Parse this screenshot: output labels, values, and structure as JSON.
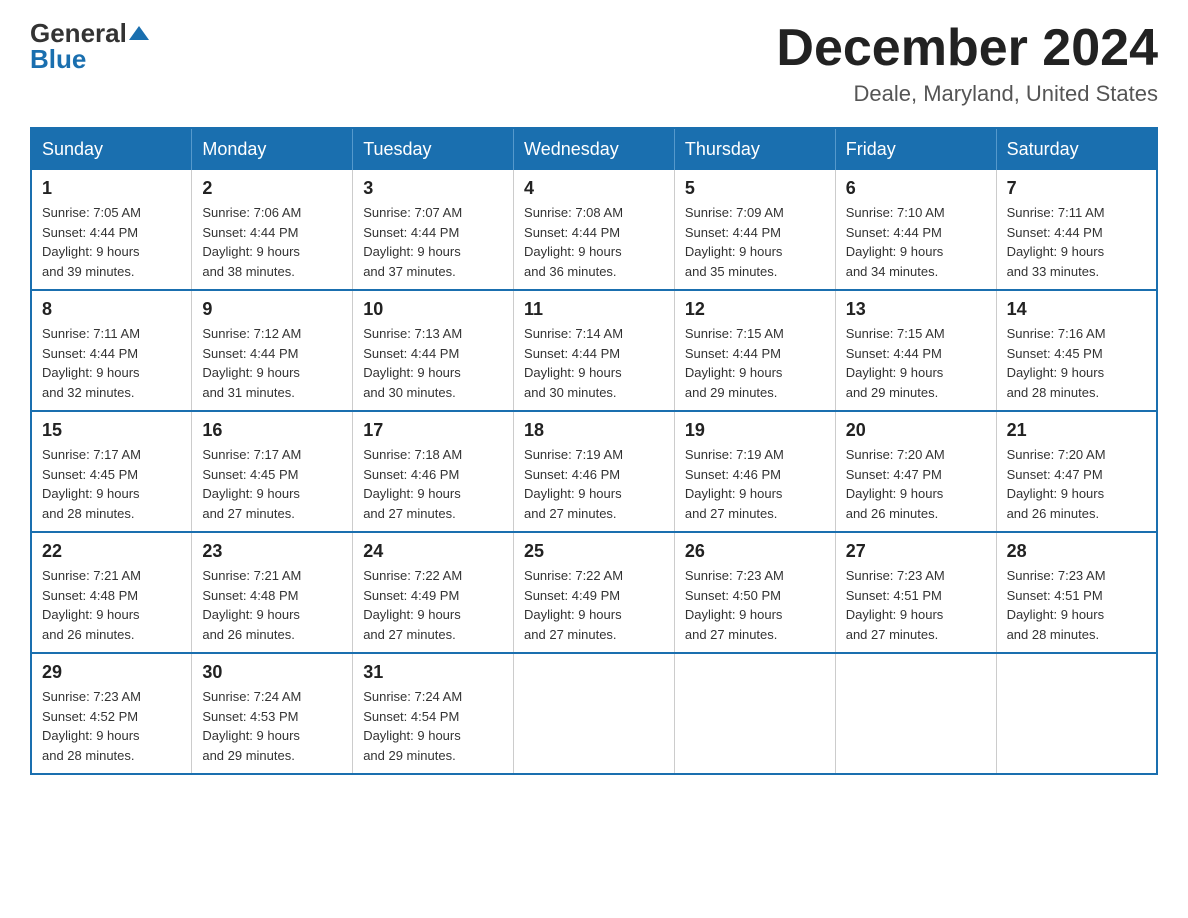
{
  "logo": {
    "general": "General",
    "blue": "Blue"
  },
  "title": {
    "month_year": "December 2024",
    "location": "Deale, Maryland, United States"
  },
  "weekdays": [
    "Sunday",
    "Monday",
    "Tuesday",
    "Wednesday",
    "Thursday",
    "Friday",
    "Saturday"
  ],
  "weeks": [
    [
      {
        "day": 1,
        "sunrise": "7:05 AM",
        "sunset": "4:44 PM",
        "daylight": "9 hours and 39 minutes."
      },
      {
        "day": 2,
        "sunrise": "7:06 AM",
        "sunset": "4:44 PM",
        "daylight": "9 hours and 38 minutes."
      },
      {
        "day": 3,
        "sunrise": "7:07 AM",
        "sunset": "4:44 PM",
        "daylight": "9 hours and 37 minutes."
      },
      {
        "day": 4,
        "sunrise": "7:08 AM",
        "sunset": "4:44 PM",
        "daylight": "9 hours and 36 minutes."
      },
      {
        "day": 5,
        "sunrise": "7:09 AM",
        "sunset": "4:44 PM",
        "daylight": "9 hours and 35 minutes."
      },
      {
        "day": 6,
        "sunrise": "7:10 AM",
        "sunset": "4:44 PM",
        "daylight": "9 hours and 34 minutes."
      },
      {
        "day": 7,
        "sunrise": "7:11 AM",
        "sunset": "4:44 PM",
        "daylight": "9 hours and 33 minutes."
      }
    ],
    [
      {
        "day": 8,
        "sunrise": "7:11 AM",
        "sunset": "4:44 PM",
        "daylight": "9 hours and 32 minutes."
      },
      {
        "day": 9,
        "sunrise": "7:12 AM",
        "sunset": "4:44 PM",
        "daylight": "9 hours and 31 minutes."
      },
      {
        "day": 10,
        "sunrise": "7:13 AM",
        "sunset": "4:44 PM",
        "daylight": "9 hours and 30 minutes."
      },
      {
        "day": 11,
        "sunrise": "7:14 AM",
        "sunset": "4:44 PM",
        "daylight": "9 hours and 30 minutes."
      },
      {
        "day": 12,
        "sunrise": "7:15 AM",
        "sunset": "4:44 PM",
        "daylight": "9 hours and 29 minutes."
      },
      {
        "day": 13,
        "sunrise": "7:15 AM",
        "sunset": "4:44 PM",
        "daylight": "9 hours and 29 minutes."
      },
      {
        "day": 14,
        "sunrise": "7:16 AM",
        "sunset": "4:45 PM",
        "daylight": "9 hours and 28 minutes."
      }
    ],
    [
      {
        "day": 15,
        "sunrise": "7:17 AM",
        "sunset": "4:45 PM",
        "daylight": "9 hours and 28 minutes."
      },
      {
        "day": 16,
        "sunrise": "7:17 AM",
        "sunset": "4:45 PM",
        "daylight": "9 hours and 27 minutes."
      },
      {
        "day": 17,
        "sunrise": "7:18 AM",
        "sunset": "4:46 PM",
        "daylight": "9 hours and 27 minutes."
      },
      {
        "day": 18,
        "sunrise": "7:19 AM",
        "sunset": "4:46 PM",
        "daylight": "9 hours and 27 minutes."
      },
      {
        "day": 19,
        "sunrise": "7:19 AM",
        "sunset": "4:46 PM",
        "daylight": "9 hours and 27 minutes."
      },
      {
        "day": 20,
        "sunrise": "7:20 AM",
        "sunset": "4:47 PM",
        "daylight": "9 hours and 26 minutes."
      },
      {
        "day": 21,
        "sunrise": "7:20 AM",
        "sunset": "4:47 PM",
        "daylight": "9 hours and 26 minutes."
      }
    ],
    [
      {
        "day": 22,
        "sunrise": "7:21 AM",
        "sunset": "4:48 PM",
        "daylight": "9 hours and 26 minutes."
      },
      {
        "day": 23,
        "sunrise": "7:21 AM",
        "sunset": "4:48 PM",
        "daylight": "9 hours and 26 minutes."
      },
      {
        "day": 24,
        "sunrise": "7:22 AM",
        "sunset": "4:49 PM",
        "daylight": "9 hours and 27 minutes."
      },
      {
        "day": 25,
        "sunrise": "7:22 AM",
        "sunset": "4:49 PM",
        "daylight": "9 hours and 27 minutes."
      },
      {
        "day": 26,
        "sunrise": "7:23 AM",
        "sunset": "4:50 PM",
        "daylight": "9 hours and 27 minutes."
      },
      {
        "day": 27,
        "sunrise": "7:23 AM",
        "sunset": "4:51 PM",
        "daylight": "9 hours and 27 minutes."
      },
      {
        "day": 28,
        "sunrise": "7:23 AM",
        "sunset": "4:51 PM",
        "daylight": "9 hours and 28 minutes."
      }
    ],
    [
      {
        "day": 29,
        "sunrise": "7:23 AM",
        "sunset": "4:52 PM",
        "daylight": "9 hours and 28 minutes."
      },
      {
        "day": 30,
        "sunrise": "7:24 AM",
        "sunset": "4:53 PM",
        "daylight": "9 hours and 29 minutes."
      },
      {
        "day": 31,
        "sunrise": "7:24 AM",
        "sunset": "4:54 PM",
        "daylight": "9 hours and 29 minutes."
      },
      null,
      null,
      null,
      null
    ]
  ],
  "labels": {
    "sunrise": "Sunrise:",
    "sunset": "Sunset:",
    "daylight": "Daylight:"
  }
}
